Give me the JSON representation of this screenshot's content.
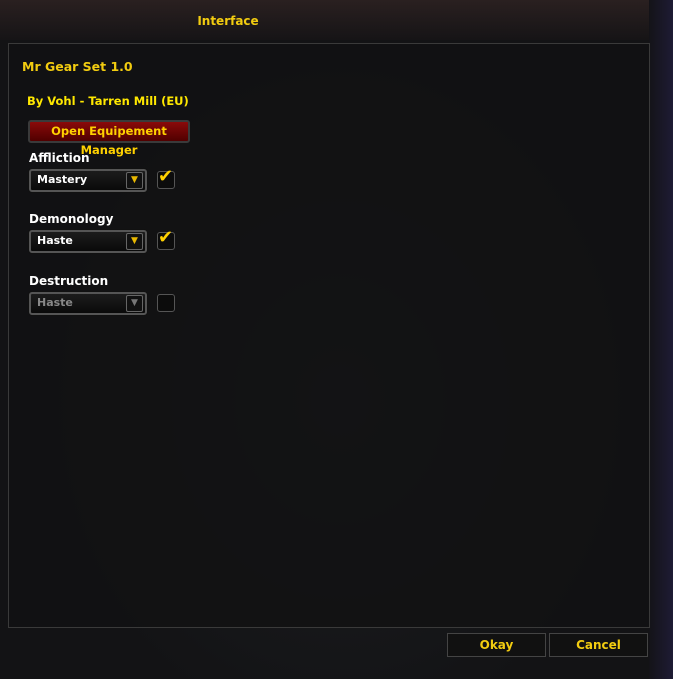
{
  "window": {
    "title": "Interface"
  },
  "addon": {
    "title": "Mr Gear Set 1.0",
    "author": "By Vohl - Tarren Mill (EU)",
    "open_button": "Open Equipement Manager"
  },
  "specs": [
    {
      "label": "Affliction",
      "value": "Mastery",
      "checked": true,
      "enabled": true
    },
    {
      "label": "Demonology",
      "value": "Haste",
      "checked": true,
      "enabled": true
    },
    {
      "label": "Destruction",
      "value": "Haste",
      "checked": false,
      "enabled": false
    }
  ],
  "footer": {
    "okay": "Okay",
    "cancel": "Cancel"
  },
  "colors": {
    "gold": "#f2cc10",
    "button_red": "#8a0a0a"
  }
}
